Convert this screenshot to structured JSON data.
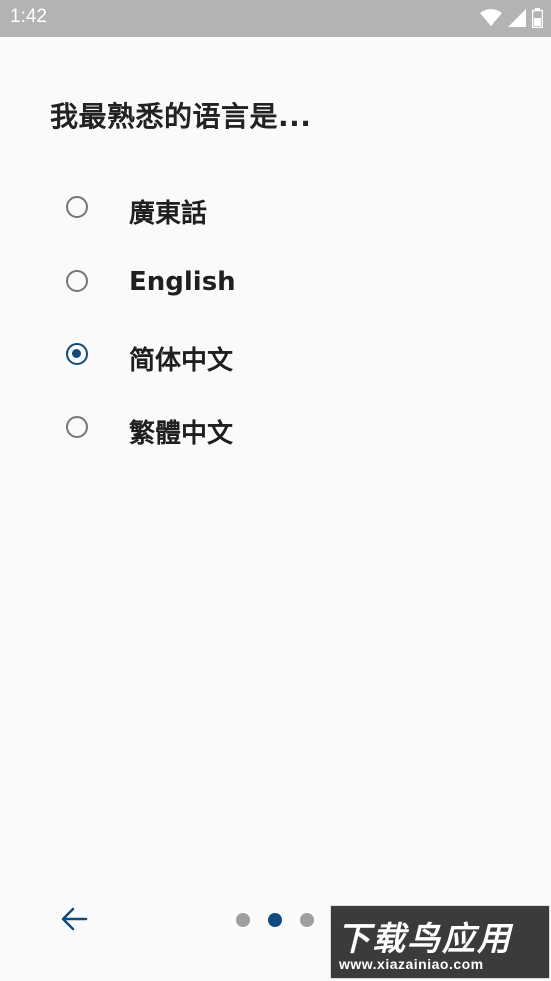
{
  "status_bar": {
    "time": "1:42",
    "icons": [
      "wifi-icon",
      "cell-signal-icon",
      "battery-icon"
    ]
  },
  "title": "我最熟悉的语言是...",
  "options": [
    {
      "label": "廣東話",
      "selected": false
    },
    {
      "label": "English",
      "selected": false
    },
    {
      "label": "简体中文",
      "selected": true
    },
    {
      "label": "繁體中文",
      "selected": false
    }
  ],
  "navigation": {
    "back_icon": "arrow-left-icon",
    "next_icon": "arrow-right-icon",
    "page_indicator": {
      "total": 3,
      "current": 2
    }
  },
  "watermark": {
    "title": "下载鸟应用",
    "url": "www.xiazainiao.com"
  },
  "colors": {
    "accent": "#114a7d",
    "status_bar": "#b3b3b3",
    "background": "#fafafa"
  }
}
